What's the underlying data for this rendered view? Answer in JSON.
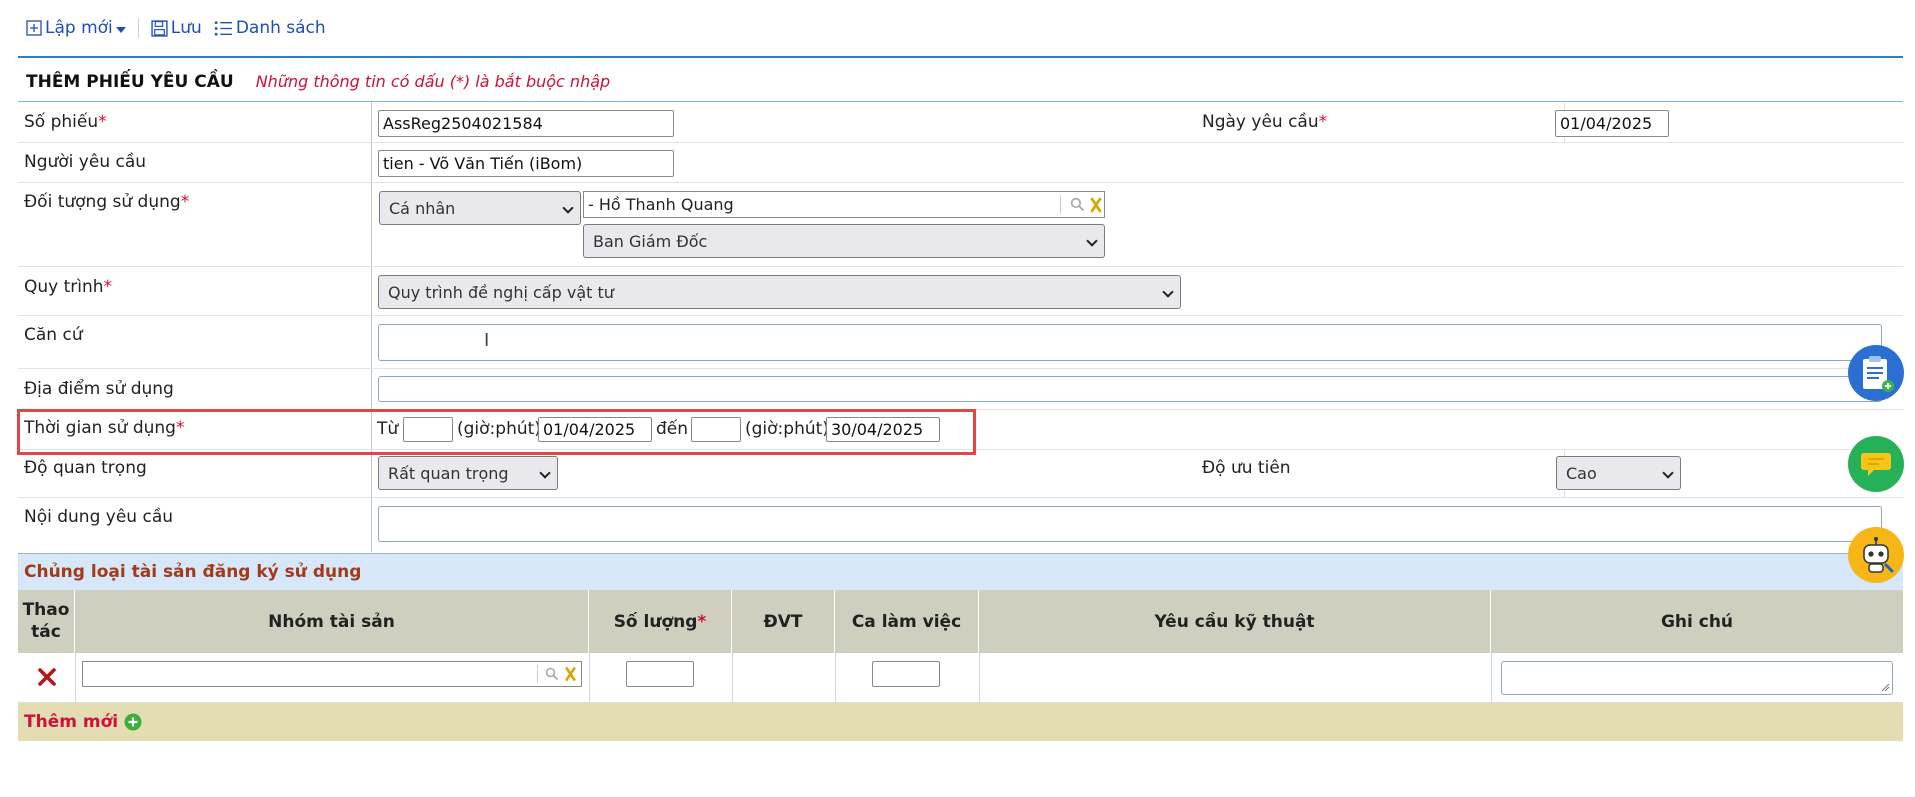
{
  "toolbar": {
    "new_label": "Lập mới",
    "save_label": "Lưu",
    "list_label": "Danh sách"
  },
  "header": {
    "title": "THÊM PHIẾU YÊU CẦU",
    "note": "Những thông tin có dấu (*) là bắt buộc nhập"
  },
  "form": {
    "ticket_no": {
      "label": "Số phiếu",
      "required": "*",
      "value": "AssReg2504021584"
    },
    "request_date": {
      "label": "Ngày yêu cầu",
      "required": "*",
      "value": "01/04/2025"
    },
    "requester": {
      "label": "Người yêu cầu",
      "value": "tien - Võ Văn Tiến (iBom)"
    },
    "user_object": {
      "label": "Đối tượng sử dụng",
      "required": "*",
      "type_value": "Cá nhân",
      "person_value": "- Hồ Thanh Quang",
      "department_value": "Ban Giám Đốc"
    },
    "process": {
      "label": "Quy trình",
      "required": "*",
      "value": "Quy trình đề nghị cấp vật tư"
    },
    "basis": {
      "label": "Căn cứ",
      "value": ""
    },
    "location": {
      "label": "Địa điểm sử dụng",
      "value": ""
    },
    "usage_time": {
      "label": "Thời gian sử dụng",
      "required": "*",
      "from_label": "Từ",
      "hm_label": "(giờ:phút)",
      "from_time": "",
      "from_date": "01/04/2025",
      "to_label": "đến",
      "to_time": "",
      "to_date": "30/04/2025"
    },
    "importance": {
      "label": "Độ quan trọng",
      "value": "Rất quan trọng"
    },
    "priority": {
      "label": "Độ ưu tiên",
      "value": "Cao"
    },
    "content": {
      "label": "Nội dung yêu cầu",
      "value": ""
    }
  },
  "assets": {
    "section_title": "Chủng loại tài sản đăng ký sử dụng",
    "columns": {
      "action": "Thao tác",
      "group": "Nhóm tài sản",
      "qty": "Số lượng",
      "qty_req": "*",
      "unit": "ĐVT",
      "shift": "Ca làm việc",
      "tech": "Yêu cầu kỹ thuật",
      "note": "Ghi chú"
    },
    "add_label": "Thêm mới"
  },
  "colors": {
    "accent": "#1f4fb4",
    "required": "#d0103a",
    "section_bg": "#d5e7f8",
    "table_head": "#cfcfbf",
    "add_bg": "#e4ddb4"
  },
  "icons": [
    "plus-square-icon",
    "save-icon",
    "list-icon",
    "search-icon",
    "clear-icon",
    "delete-icon",
    "add-circle-icon",
    "clipboard-icon",
    "chat-icon",
    "robot-icon"
  ]
}
